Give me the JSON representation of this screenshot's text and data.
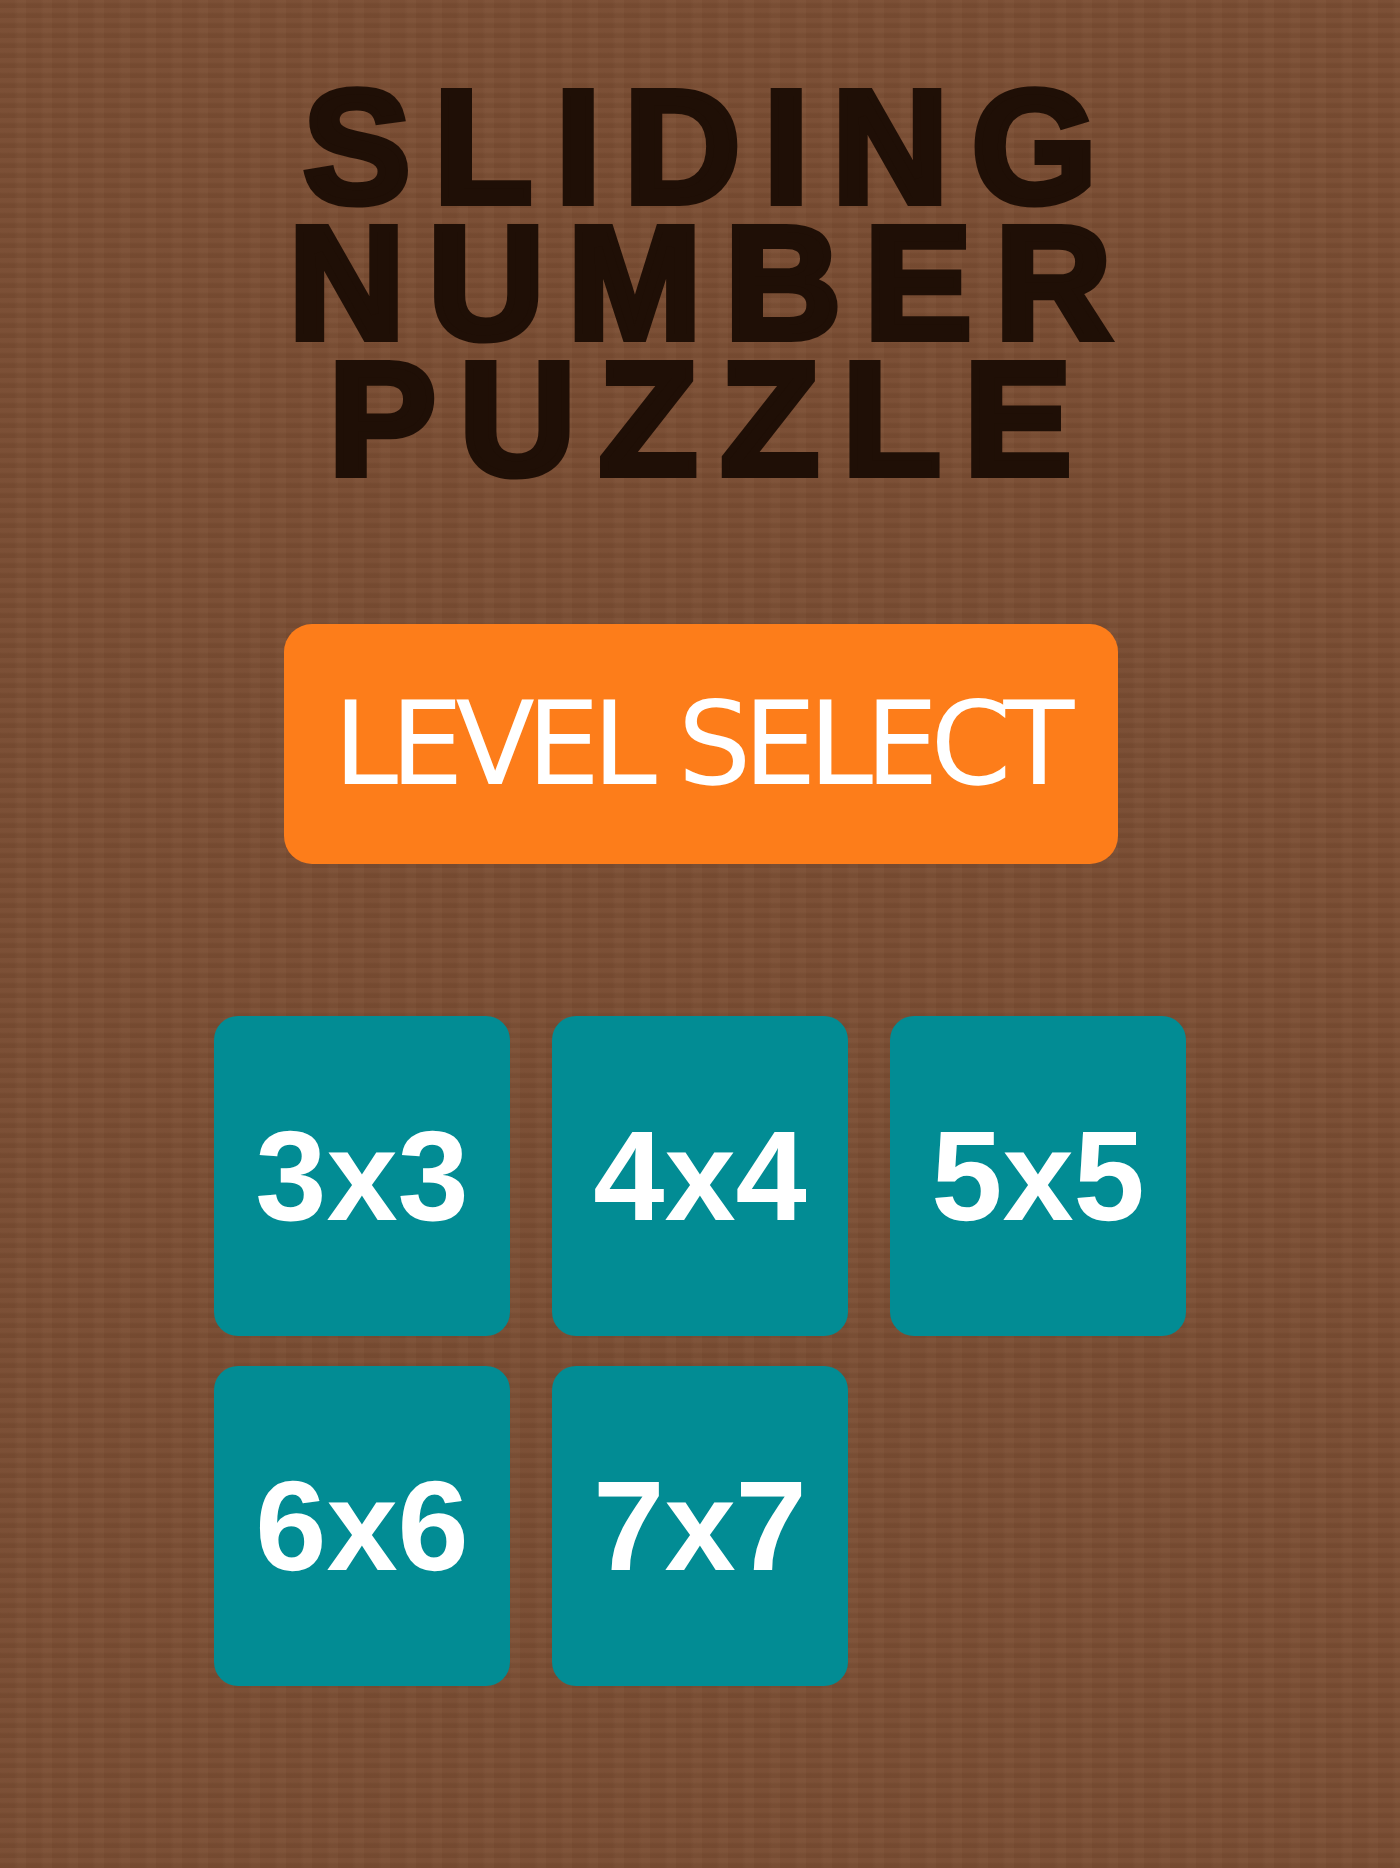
{
  "title": "SLIDING NUMBER PUZZLE",
  "banner": {
    "label": "LEVEL SELECT"
  },
  "levels": [
    {
      "label": "3x3"
    },
    {
      "label": "4x4"
    },
    {
      "label": "5x5"
    },
    {
      "label": "6x6"
    },
    {
      "label": "7x7"
    }
  ]
}
